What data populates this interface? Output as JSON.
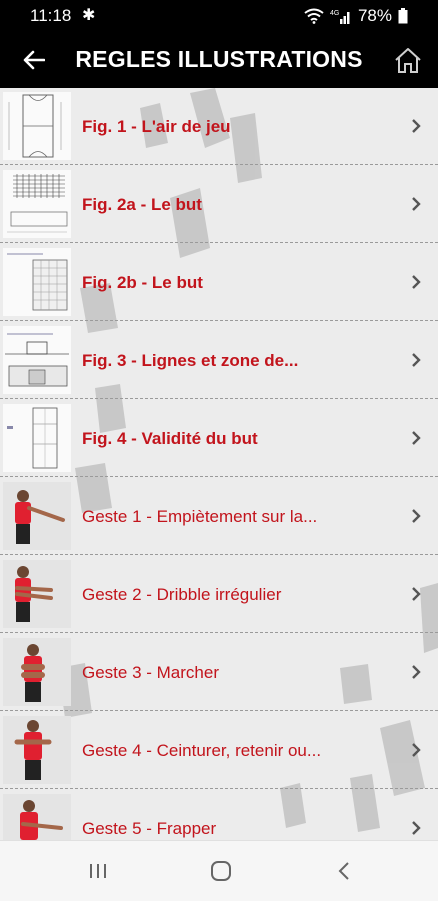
{
  "status": {
    "time": "11:18",
    "battery": "78%"
  },
  "header": {
    "title": "REGLES ILLUSTRATIONS",
    "back_icon": "back-arrow-icon",
    "home_icon": "home-icon"
  },
  "colors": {
    "accent": "#c2141c",
    "bar": "#000000"
  },
  "items": [
    {
      "label": "Fig. 1 - L'air de jeu",
      "thumb": "court-diagram"
    },
    {
      "label": "Fig. 2a - Le but",
      "thumb": "goal-net-diagram"
    },
    {
      "label": "Fig. 2b - Le but",
      "thumb": "goal-side-diagram"
    },
    {
      "label": "Fig. 3 - Lignes et zone de...",
      "thumb": "goal-area-lines-diagram"
    },
    {
      "label": "Fig. 4 - Validité du but",
      "thumb": "goal-validity-diagram"
    },
    {
      "label": "Geste 1 - Empiètement sur la...",
      "thumb": "referee-gesture-photo"
    },
    {
      "label": "Geste 2 - Dribble irrégulier",
      "thumb": "referee-gesture-photo"
    },
    {
      "label": "Geste 3 - Marcher",
      "thumb": "referee-gesture-photo"
    },
    {
      "label": "Geste 4 - Ceinturer, retenir ou...",
      "thumb": "referee-gesture-photo"
    },
    {
      "label": "Geste 5 - Frapper",
      "thumb": "referee-gesture-photo"
    }
  ],
  "nav": {
    "recents_icon": "recents-icon",
    "home_icon": "home-circle-icon",
    "back_icon": "nav-back-icon"
  }
}
